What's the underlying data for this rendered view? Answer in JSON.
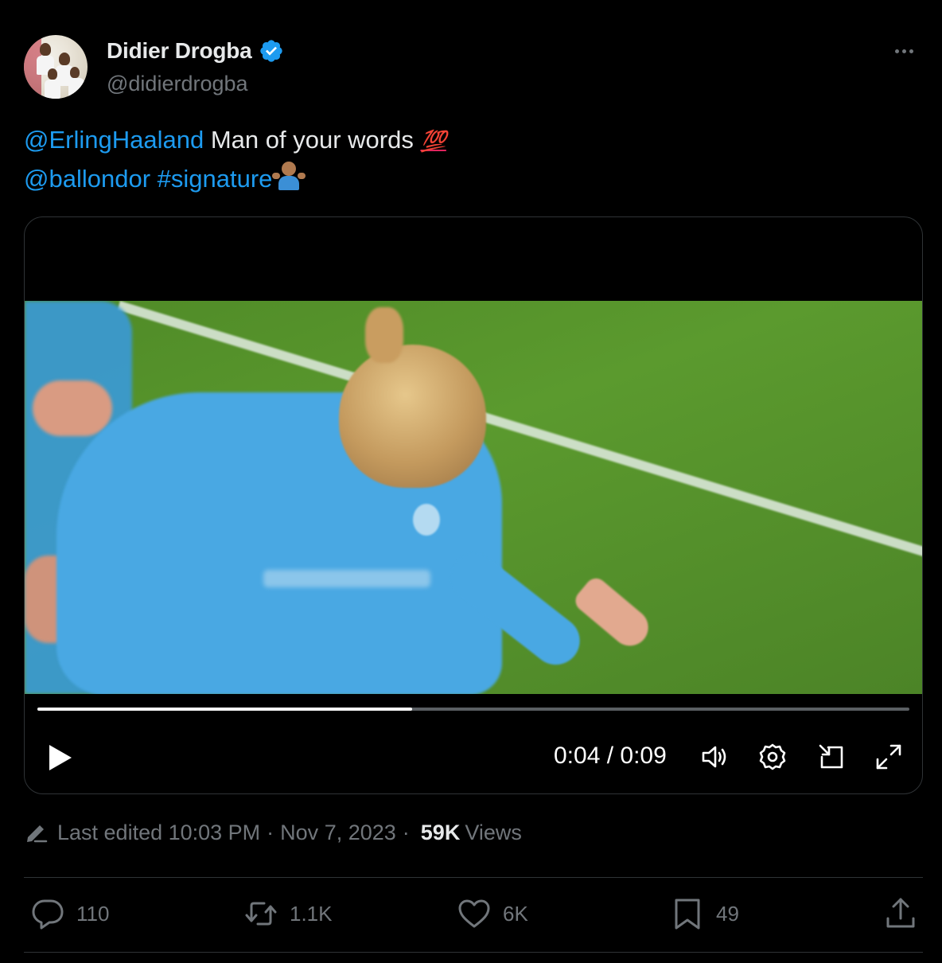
{
  "author": {
    "display_name": "Didier Drogba",
    "handle": "@didierdrogba",
    "verified": true
  },
  "tweet": {
    "mention_1": "@ErlingHaaland",
    "text_1": "Man of your words",
    "emoji_1": "💯",
    "mention_2": "@ballondor",
    "hashtag": "#signature",
    "emoji_2": "🤷🏽‍♂️"
  },
  "video": {
    "current_time": "0:04",
    "duration": "0:09",
    "time_display": "0:04 / 0:09",
    "progress_fraction": 0.43
  },
  "meta": {
    "edited_label": "Last edited 10:03 PM",
    "separator": "·",
    "date": "Nov 7, 2023",
    "views_count": "59K",
    "views_label": "Views"
  },
  "actions": {
    "replies": "110",
    "reposts": "1.1K",
    "likes": "6K",
    "bookmarks": "49"
  },
  "colors": {
    "background": "#000000",
    "link": "#1d9bf0",
    "text": "#e7e9ea",
    "muted": "#71767b",
    "border": "#2f3336"
  },
  "icons": [
    "more-icon",
    "verified-icon",
    "play-icon",
    "volume-icon",
    "settings-icon",
    "pip-icon",
    "fullscreen-icon",
    "pencil-icon",
    "reply-icon",
    "repost-icon",
    "like-icon",
    "bookmark-icon",
    "share-icon"
  ]
}
